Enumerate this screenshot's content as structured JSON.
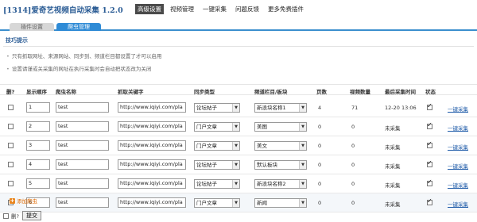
{
  "app": {
    "title": "[1314]爱奇艺视频自动采集 1.2.0",
    "nav": [
      "高级设置",
      "视频管理",
      "一键采集",
      "问题反馈",
      "更多免费插件"
    ],
    "active_nav": "高级设置"
  },
  "tabs": [
    "插件设置",
    "爬虫管理"
  ],
  "active_tab": "爬虫管理",
  "tips": {
    "heading": "技巧提示",
    "items": [
      "只有抓取网址、来源网站、同步到、频道栏目都设置了才可以启用",
      "设置请谨或关采集的网址在执行采集时会自动把状态改为关闭"
    ]
  },
  "table": {
    "headers": [
      "删?",
      "显示顺序",
      "爬虫名称",
      "抓取关键字",
      "同步类型",
      "频道栏目/板块",
      "页数",
      "视频数量",
      "最后采集时间",
      "状态"
    ],
    "rows": [
      {
        "order": "1",
        "name": "test",
        "url": "http://www.iqiyi.com/pla",
        "type": "论坛帖子",
        "channel": "新浪块名称1",
        "pages": "4",
        "videos": "71",
        "last": "12-20 13:06",
        "status": true,
        "action": "一键采集"
      },
      {
        "order": "2",
        "name": "test",
        "url": "http://www.iqiyi.com/pla",
        "type": "门户文章",
        "channel": "美图",
        "pages": "0",
        "videos": "0",
        "last": "未采集",
        "status": true,
        "action": "一键采集"
      },
      {
        "order": "3",
        "name": "test",
        "url": "http://www.iqiyi.com/pla",
        "type": "门户文章",
        "channel": "美文",
        "pages": "0",
        "videos": "0",
        "last": "未采集",
        "status": true,
        "action": "一键采集"
      },
      {
        "order": "4",
        "name": "test",
        "url": "http://www.iqiyi.com/pla",
        "type": "论坛帖子",
        "channel": "默认板块",
        "pages": "0",
        "videos": "0",
        "last": "未采集",
        "status": true,
        "action": "一键采集"
      },
      {
        "order": "5",
        "name": "test",
        "url": "http://www.iqiyi.com/pla",
        "type": "论坛帖子",
        "channel": "新浪块名称2",
        "pages": "0",
        "videos": "0",
        "last": "未采集",
        "status": true,
        "action": "一键采集"
      },
      {
        "order": "6",
        "name": "test",
        "url": "http://www.iqiyi.com/pla",
        "type": "门户文章",
        "channel": "新闻",
        "pages": "0",
        "videos": "0",
        "last": "未采集",
        "status": true,
        "action": "一键采集"
      }
    ]
  },
  "add_label": "添加爬虫",
  "footer": {
    "delete_label": "删?",
    "submit_label": "提交"
  }
}
